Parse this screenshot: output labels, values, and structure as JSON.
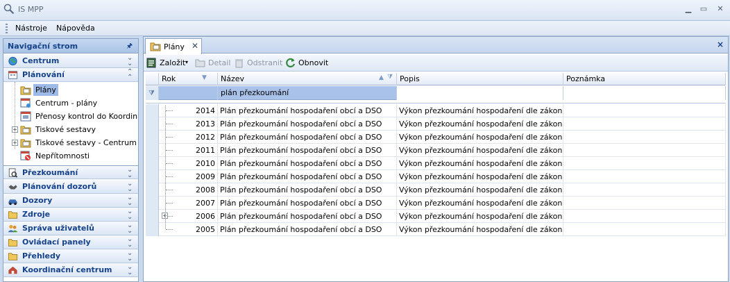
{
  "window": {
    "title": "IS MPP"
  },
  "menu": {
    "items": [
      "Nástroje",
      "Nápověda"
    ]
  },
  "nav": {
    "header": "Navigační strom",
    "groups_top": [
      {
        "label": "Centrum",
        "icon": "globe-icon"
      },
      {
        "label": "Plánování",
        "icon": "calendar-icon"
      }
    ],
    "tree": [
      {
        "label": "Plány",
        "icon": "folder-icon",
        "selected": true,
        "expandable": false
      },
      {
        "label": "Centrum - plány",
        "icon": "calendar-icon",
        "selected": false,
        "expandable": false
      },
      {
        "label": "Přenosy kontrol do Koordin...",
        "icon": "grid-icon",
        "selected": false,
        "expandable": false
      },
      {
        "label": "Tiskové sestavy",
        "icon": "folder-icon",
        "selected": false,
        "expandable": true
      },
      {
        "label": "Tiskové sestavy - Centrum",
        "icon": "folder-icon",
        "selected": false,
        "expandable": true
      },
      {
        "label": "Nepřítomnosti",
        "icon": "absence-icon",
        "selected": false,
        "expandable": false
      }
    ],
    "groups_bottom": [
      {
        "label": "Přezkoumání",
        "icon": "review-icon"
      },
      {
        "label": "Plánování dozorů",
        "icon": "handshake-icon"
      },
      {
        "label": "Dozory",
        "icon": "car-icon"
      },
      {
        "label": "Zdroje",
        "icon": "folder-icon"
      },
      {
        "label": "Správa uživatelů",
        "icon": "users-icon"
      },
      {
        "label": "Ovládací panely",
        "icon": "folder-icon"
      },
      {
        "label": "Přehledy",
        "icon": "folder-icon"
      },
      {
        "label": "Koordinační centrum",
        "icon": "house-icon"
      }
    ]
  },
  "tab": {
    "label": "Plány",
    "close": "✕"
  },
  "toolbar": {
    "create": "Založit",
    "detail": "Detail",
    "delete": "Odstranit",
    "refresh": "Obnovit"
  },
  "grid": {
    "columns": [
      "Rok",
      "Název",
      "Popis",
      "Poznámka"
    ],
    "filter": {
      "nazev": "plán přezkoumání"
    },
    "rows": [
      {
        "rok": "2014",
        "nazev": "Plán přezkoumání hospodaření obcí a DSO",
        "popis": "Výkon přezkoumání hospodaření dle zákona č....",
        "poznamka": ""
      },
      {
        "rok": "2013",
        "nazev": "Plán přezkoumání hospodaření obcí a DSO",
        "popis": "Výkon přezkoumání hospodaření dle zákona č....",
        "poznamka": ""
      },
      {
        "rok": "2012",
        "nazev": "Plán přezkoumání hospodaření obcí a DSO",
        "popis": "Výkon přezkoumání hospodaření dle zákona č....",
        "poznamka": ""
      },
      {
        "rok": "2011",
        "nazev": "Plán přezkoumání hospodaření obcí a DSO",
        "popis": "Výkon přezkoumání hospodaření dle zákona č....",
        "poznamka": ""
      },
      {
        "rok": "2010",
        "nazev": "Plán přezkoumání hospodaření obcí a DSO",
        "popis": "Výkon přezkoumání hospodaření dle zákona č....",
        "poznamka": ""
      },
      {
        "rok": "2009",
        "nazev": "Plán přezkoumání hospodaření obcí a DSO",
        "popis": "Výkon přezkoumání hospodaření dle zákona č....",
        "poznamka": ""
      },
      {
        "rok": "2008",
        "nazev": "Plán přezkoumání hospodaření obcí a DSO",
        "popis": "Výkon přezkoumání hospodaření dle zákona č....",
        "poznamka": ""
      },
      {
        "rok": "2007",
        "nazev": "Plán přezkoumání hospodaření obcí a DSO",
        "popis": "Výkon přezkoumání hospodaření dle zákona č....",
        "poznamka": ""
      },
      {
        "rok": "2006",
        "nazev": "Plán přezkoumání hospodaření obcí a DSO",
        "popis": "Výkon přezkoumání hospodaření dle zákona č....",
        "poznamka": ""
      },
      {
        "rok": "2005",
        "nazev": "Plán přezkoumání hospodaření obcí a DSO",
        "popis": "Výkon přezkoumání hospodaření dle zákona č....",
        "poznamka": ""
      }
    ]
  }
}
